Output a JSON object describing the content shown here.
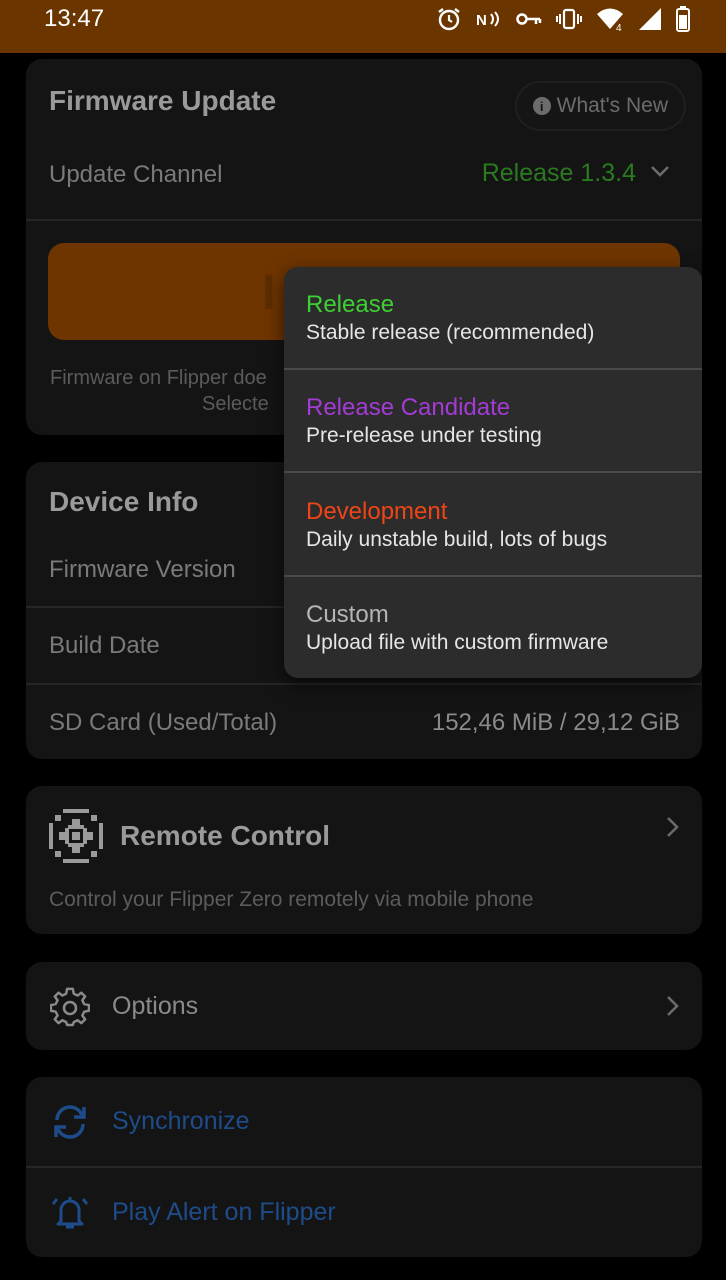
{
  "status_bar": {
    "time": "13:47"
  },
  "firmware_update": {
    "title": "Firmware Update",
    "whats_new_label": "What's New",
    "update_channel_label": "Update Channel",
    "update_channel_value": "Release 1.3.4",
    "update_button_label": "I",
    "note_line1": "Firmware on Flipper doe",
    "note_line2": "Selecte"
  },
  "device_info": {
    "title": "Device Info",
    "rows": [
      {
        "label": "Firmware Version",
        "value": ""
      },
      {
        "label": "Build Date",
        "value": ""
      },
      {
        "label": "SD Card (Used/Total)",
        "value": "152,46 MiB / 29,12 GiB"
      }
    ]
  },
  "remote_control": {
    "title": "Remote Control",
    "description": "Control your Flipper Zero remotely via mobile phone"
  },
  "options": {
    "label": "Options"
  },
  "actions": {
    "synchronize": "Synchronize",
    "play_alert": "Play Alert on Flipper"
  },
  "channel_menu": {
    "items": [
      {
        "title": "Release",
        "description": "Stable release (recommended)",
        "color": "#3ecf33"
      },
      {
        "title": "Release Candidate",
        "description": "Pre-release under testing",
        "color": "#a43bd6"
      },
      {
        "title": "Development",
        "description": "Daily unstable build, lots of bugs",
        "color": "#ee4517"
      },
      {
        "title": "Custom",
        "description": "Upload file with custom firmware",
        "color": "#b5b5b5"
      }
    ]
  },
  "colors": {
    "status_bar": "#6b3500",
    "accent_orange": "#6e3500",
    "release_green": "#3ecf33",
    "candidate_purple": "#a43bd6",
    "development_red": "#ee4517",
    "action_blue": "#1e4c8a"
  }
}
